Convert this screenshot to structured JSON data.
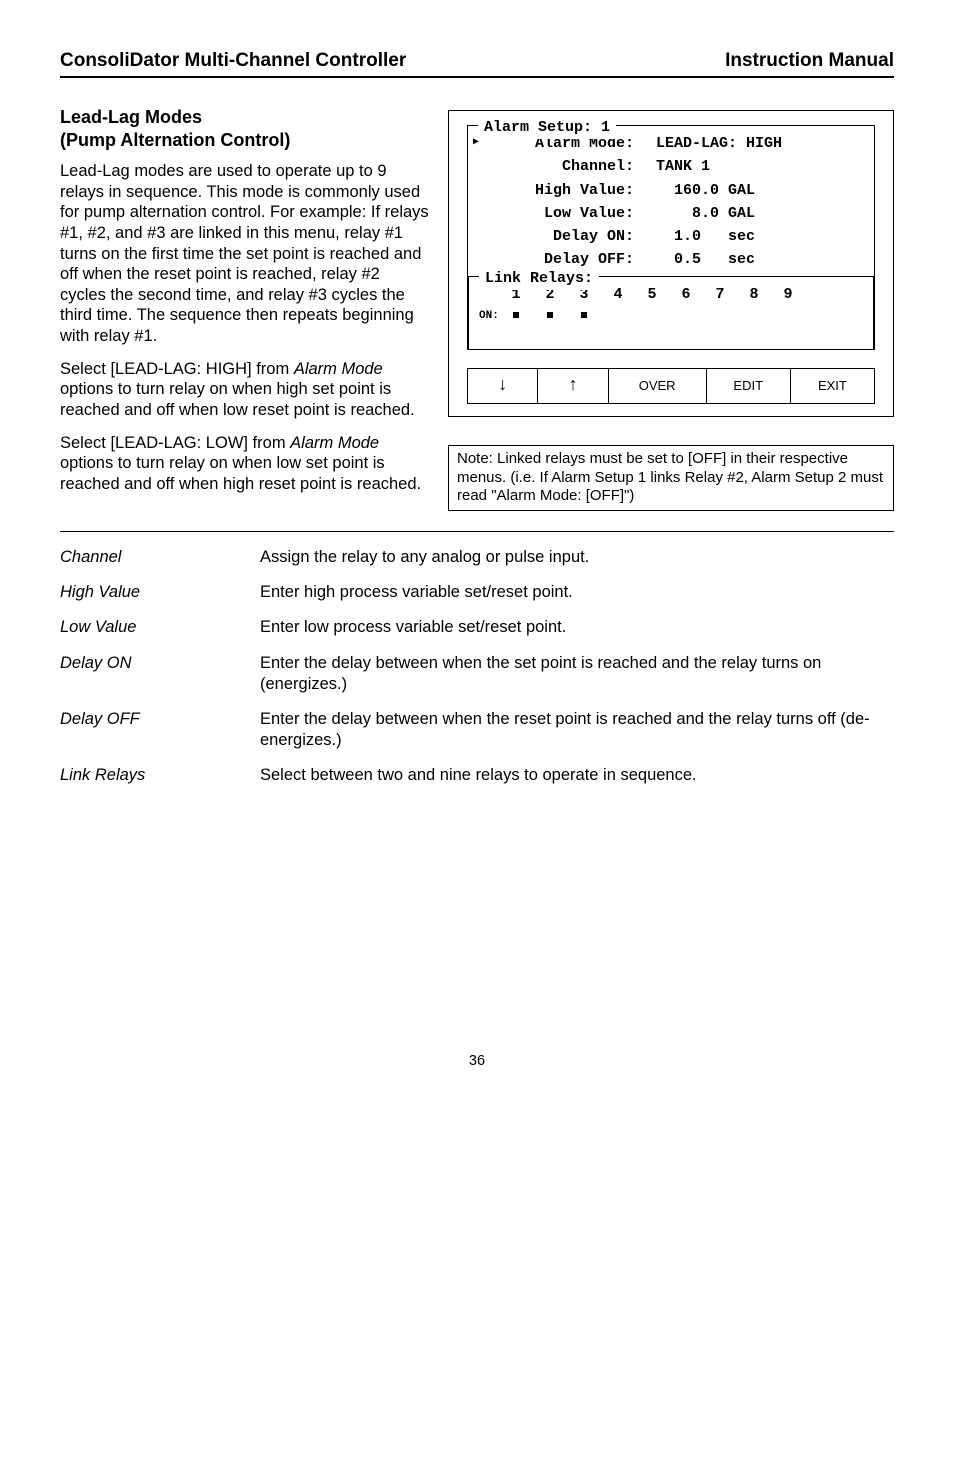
{
  "header": {
    "left": "ConsoliDator Multi-Channel Controller",
    "right": "Instruction Manual"
  },
  "section": {
    "title_line1": "Lead-Lag Modes",
    "title_line2": "(Pump Alternation Control)",
    "p1": "Lead-Lag modes are used to operate up to 9 relays in sequence. This mode is commonly used for pump alternation control. For example: If relays #1, #2, and #3 are linked in this menu, relay #1 turns on the first time the set point is reached and off when the reset point is reached, relay #2 cycles the second time, and relay #3 cycles the third time. The sequence then repeats beginning with relay #1.",
    "p2a": "Select [LEAD-LAG: HIGH] from ",
    "p2_em": "Alarm Mode",
    "p2b": " options to turn relay on when high set point is reached and off when low reset point is reached.",
    "p3a": "Select [LEAD-LAG: LOW] from ",
    "p3_em": "Alarm Mode",
    "p3b": " options to turn relay on when low set point is reached and off when high reset point is reached."
  },
  "lcd": {
    "title": "Alarm Setup: 1",
    "rows": [
      {
        "label": "Alarm Mode:",
        "value": "LEAD-LAG: HIGH",
        "cursor": true
      },
      {
        "label": "Channel:",
        "value": "TANK 1"
      },
      {
        "label": "High Value:",
        "value": "  160.0 GAL"
      },
      {
        "label": "Low Value:",
        "value": "    8.0 GAL"
      },
      {
        "label": "Delay ON:",
        "value": "  1.0   sec"
      },
      {
        "label": "Delay OFF:",
        "value": "  0.5   sec"
      }
    ],
    "link_title": "Link Relays:",
    "relays": [
      "1",
      "2",
      "3",
      "4",
      "5",
      "6",
      "7",
      "8",
      "9"
    ],
    "on_label": "ON:",
    "on_states": [
      true,
      true,
      true,
      false,
      false,
      false,
      false,
      false,
      false
    ],
    "buttons": {
      "down": "↓",
      "up": "↑",
      "over": "OVER",
      "edit": "EDIT",
      "exit": "EXIT"
    }
  },
  "note": "Note: Linked relays must be set to [OFF] in their respective menus. (i.e. If Alarm Setup 1 links Relay #2, Alarm Setup 2 must read \"Alarm Mode: [OFF]\")",
  "defs": [
    {
      "term": "Channel",
      "desc": "Assign the relay to any analog or pulse input."
    },
    {
      "term": "High Value",
      "desc": "Enter high process variable set/reset point."
    },
    {
      "term": "Low Value",
      "desc": "Enter low process variable set/reset point."
    },
    {
      "term": "Delay ON",
      "desc": "Enter the delay between when the set point is reached and the relay turns on (energizes.)"
    },
    {
      "term": "Delay OFF",
      "desc": "Enter the delay between when the reset point is reached and the relay turns off (de-energizes.)"
    },
    {
      "term": "Link Relays",
      "desc": "Select between two and nine relays to operate in sequence."
    }
  ],
  "page_number": "36"
}
